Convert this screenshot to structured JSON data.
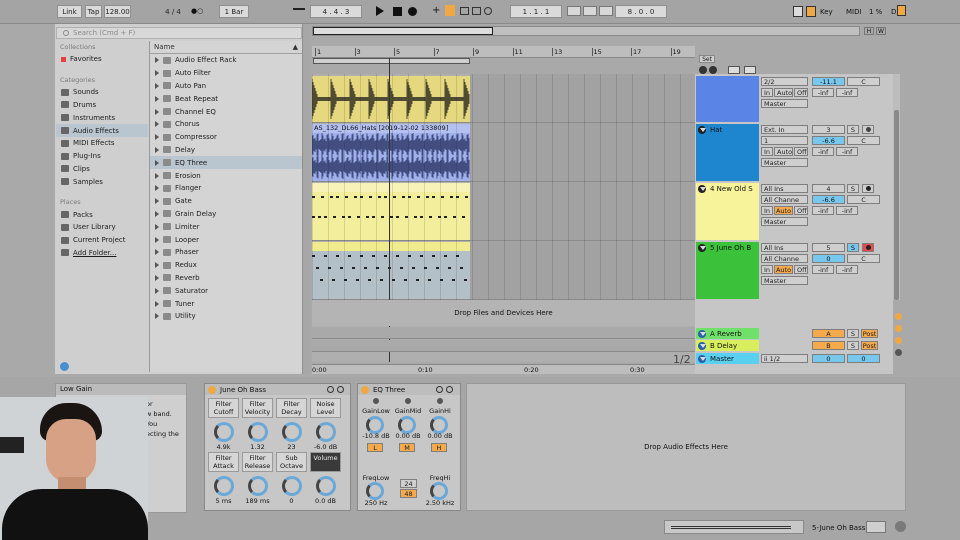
{
  "toolbar": {
    "link": "Link",
    "tap": "Tap",
    "tempo": "128.00",
    "sig": "4 / 4",
    "metro": "●○",
    "quant": "1 Bar",
    "arr_pos": "4 . 4 . 3",
    "arr_pos2": "1 . 1 . 1",
    "loop_len": "8 . 0 . 0",
    "key": "Key",
    "midi": "MIDI",
    "cpu": "1 %",
    "d": "D"
  },
  "browser": {
    "search_placeholder": "Search (Cmd + F)",
    "collections_head": "Collections",
    "favorites": "Favorites",
    "categories_head": "Categories",
    "categories": [
      "Sounds",
      "Drums",
      "Instruments",
      "Audio Effects",
      "MIDI Effects",
      "Plug-Ins",
      "Clips",
      "Samples"
    ],
    "places_head": "Places",
    "places": [
      "Packs",
      "User Library",
      "Current Project",
      "Add Folder..."
    ],
    "name_col": "Name",
    "items": [
      "Audio Effect Rack",
      "Auto Filter",
      "Auto Pan",
      "Beat Repeat",
      "Channel EQ",
      "Chorus",
      "Compressor",
      "Delay",
      "EQ Three",
      "Erosion",
      "Flanger",
      "Gate",
      "Grain Delay",
      "Limiter",
      "Looper",
      "Phaser",
      "Redux",
      "Reverb",
      "Saturator",
      "Tuner",
      "Utility"
    ]
  },
  "arrangement": {
    "bars": [
      "1",
      "3",
      "5",
      "7",
      "9",
      "11",
      "13",
      "15",
      "17",
      "19"
    ],
    "clip_name": "AS_132_DL66_Hats [2019-12-02 133809]",
    "drop_text": "Drop Files and Devices Here",
    "times": [
      "0:00",
      "0:10",
      "0:20",
      "0:30"
    ],
    "page": "1/2",
    "set_label": "Set"
  },
  "tracks": [
    {
      "name": "",
      "input": "2/2",
      "num": "-11.1",
      "pan": "C",
      "vol": "-inf",
      "send": "-inf",
      "out": "Master"
    },
    {
      "name": "Hat",
      "input": "Ext. In",
      "sub": "1",
      "num": "3",
      "vol": "-6.6",
      "pan": "C",
      "s1": "-inf",
      "s2": "-inf",
      "out": "Master"
    },
    {
      "name": "4 New Old S",
      "input": "All Ins",
      "sub": "All Channe",
      "num": "4",
      "vol": "-6.6",
      "pan": "C",
      "s1": "-inf",
      "s2": "-inf",
      "out": "Master"
    },
    {
      "name": "5 June Oh B",
      "input": "All Ins",
      "sub": "All Channe",
      "num": "5",
      "vol": "0",
      "pan": "C",
      "s1": "-inf",
      "s2": "-inf",
      "out": "Master"
    }
  ],
  "returns": [
    {
      "name": "A Reverb",
      "letter": "A",
      "post": "Post"
    },
    {
      "name": "B Delay",
      "letter": "B",
      "post": "Post"
    },
    {
      "name": "Master",
      "cue": "ii 1/2",
      "vol": "0",
      "pan": "0"
    }
  ],
  "monitor": {
    "in": "In",
    "auto": "Auto",
    "off": "Off",
    "s": "S"
  },
  "info": {
    "title": "Low Gain",
    "lines": [
      "or",
      "w band. You",
      "ecting the"
    ]
  },
  "device1": {
    "title": "June Oh Bass",
    "params": [
      {
        "name": "Filter\nCutoff",
        "value": "4.9k"
      },
      {
        "name": "Filter\nVelocity",
        "value": "1.32"
      },
      {
        "name": "Filter\nDecay",
        "value": "23"
      },
      {
        "name": "Noise\nLevel",
        "value": "-6.0 dB"
      },
      {
        "name": "Filter\nAttack",
        "value": "5 ms"
      },
      {
        "name": "Filter\nRelease",
        "value": "189 ms"
      },
      {
        "name": "Sub\nOctave",
        "value": "0"
      },
      {
        "name": "Volume",
        "value": "0.0 dB"
      }
    ]
  },
  "device2": {
    "title": "EQ Three",
    "gains": [
      {
        "name": "GainLow",
        "value": "-10.8 dB",
        "btn": "L"
      },
      {
        "name": "GainMid",
        "value": "0.00 dB",
        "btn": "M"
      },
      {
        "name": "GainHi",
        "value": "0.00 dB",
        "btn": "H"
      }
    ],
    "freqlow": {
      "name": "FreqLow",
      "value": "250 Hz"
    },
    "slope": [
      "24",
      "48"
    ],
    "freqhi": {
      "name": "FreqHi",
      "value": "2.50 kHz"
    }
  },
  "drop_effects": "Drop Audio Effects Here",
  "status": {
    "track": "5-June Oh Bass"
  }
}
